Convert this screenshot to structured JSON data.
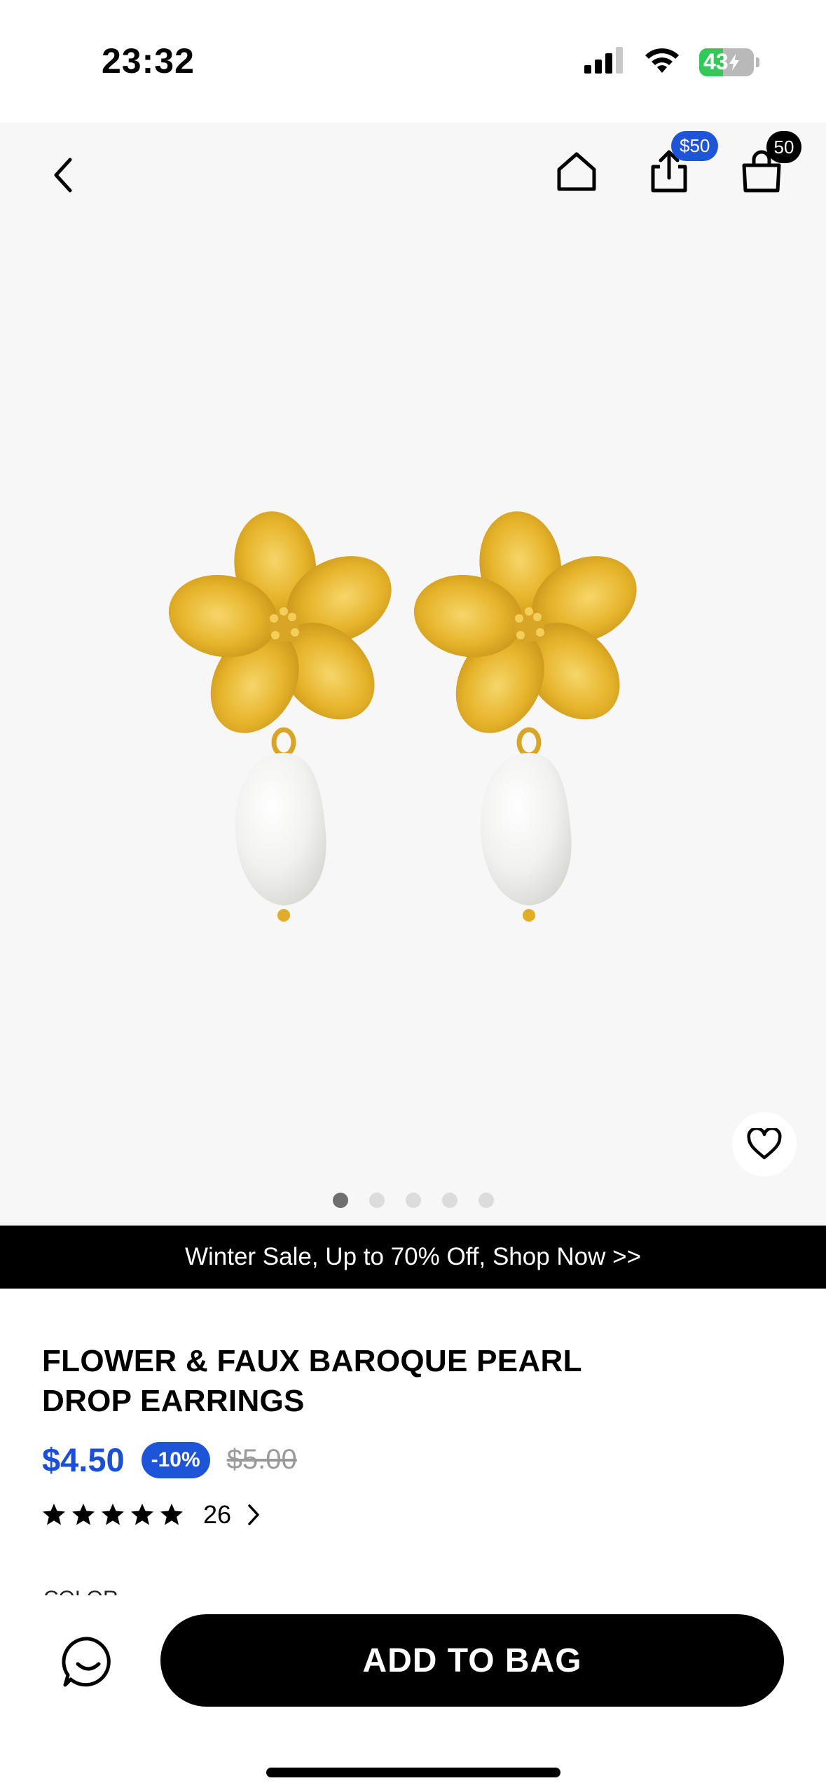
{
  "status_bar": {
    "time": "23:32",
    "battery": "43",
    "battery_level": 0.43
  },
  "nav": {
    "share_badge": "$50",
    "bag_badge": "50"
  },
  "gallery": {
    "image_count": 5,
    "active_index": 0
  },
  "promo_banner": "Winter Sale, Up to 70% Off, Shop Now >>",
  "product": {
    "title_line1": "FLOWER & FAUX BAROQUE PEARL",
    "title_line2": "DROP EARRINGS",
    "price": "$4.50",
    "discount": "-10%",
    "original_price": "$5.00",
    "rating_stars": 5,
    "review_count": "26",
    "peek_text": "COLOR"
  },
  "actions": {
    "add_to_bag": "ADD TO BAG"
  },
  "colors": {
    "accent_blue": "#1e55d8",
    "price_blue": "#1a4fd6",
    "battery_green": "#34c759",
    "gold": "#e8b62c",
    "pearl": "#f4f4f2"
  }
}
